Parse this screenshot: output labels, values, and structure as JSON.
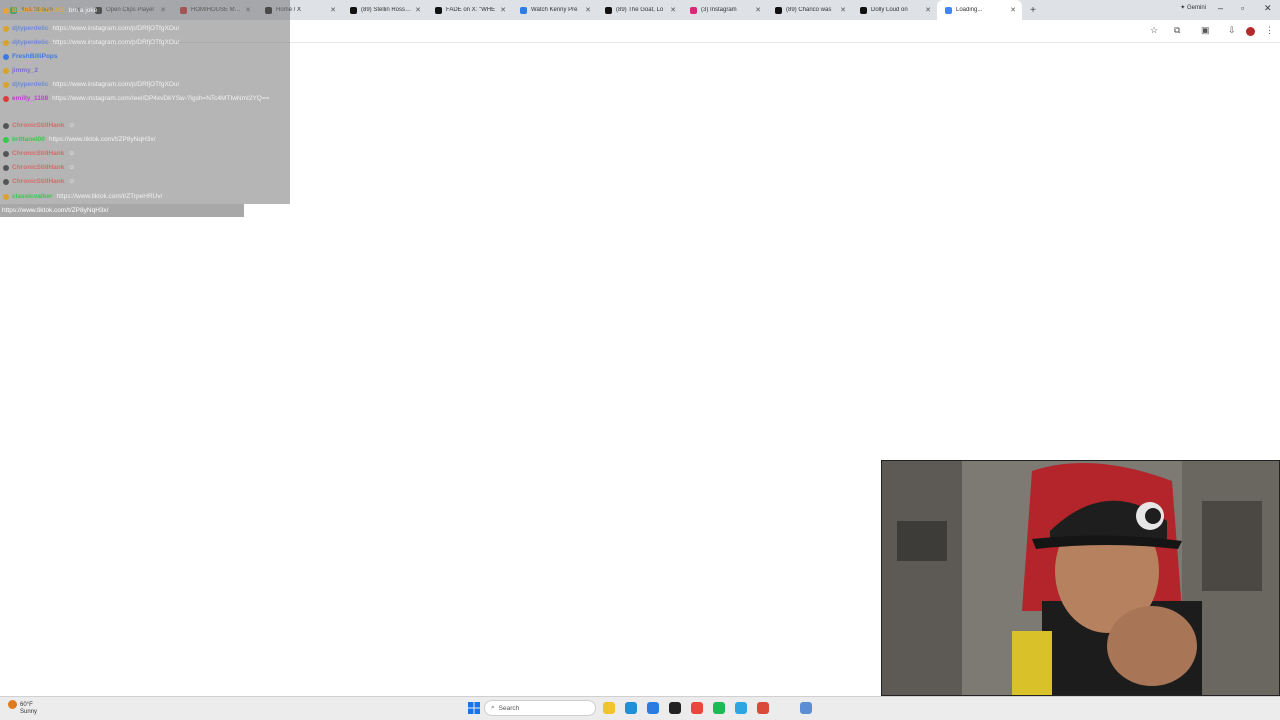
{
  "browser": {
    "tabs": [
      {
        "title": "Kick Stream",
        "color": "#2bd14b"
      },
      {
        "title": "Open Clips Player",
        "color": "#222222"
      },
      {
        "title": "HOMIHOUSE MU...",
        "color": "#e02424"
      },
      {
        "title": "Home / X",
        "color": "#111111"
      },
      {
        "title": "(89) Stellin Ross: In",
        "color": "#111111"
      },
      {
        "title": "FADE on X: \"WHE",
        "color": "#111111"
      },
      {
        "title": "Watch Kenny Pre",
        "color": "#2f7de1"
      },
      {
        "title": "(89) The Goat, Lo",
        "color": "#111111"
      },
      {
        "title": "(3) Instagram",
        "color": "#d62976"
      },
      {
        "title": "(89) Chanco was",
        "color": "#111111"
      },
      {
        "title": "Dolly Loud on",
        "color": "#111111"
      },
      {
        "title": "Loading...",
        "color": "#4285f4"
      }
    ],
    "gemini_label": "✦ Gemini",
    "new_tab_label": "+"
  },
  "chat": {
    "messages": [
      {
        "user": "BLURRED NAME",
        "user_color": "#e8a33a",
        "badge": "#e8a33a",
        "text": "bro a joke"
      },
      {
        "user": "djtyperdelic",
        "user_color": "#6d8cd6",
        "badge": "#d9a22b",
        "text": "https://www.instagram.com/p/DRfjOTfgXOu/"
      },
      {
        "user": "djtyperdelic",
        "user_color": "#6d8cd6",
        "badge": "#d9a22b",
        "text": "https://www.instagram.com/p/DRfjOTfgXOu/"
      },
      {
        "user": "FreshBilliPops",
        "user_color": "#3b7be0",
        "badge": "#3b7be0",
        "text": ""
      },
      {
        "user": "jimmy_2",
        "user_color": "#7c6ad0",
        "badge": "#d9a22b",
        "text": ""
      },
      {
        "user": "djtyperdelic",
        "user_color": "#6d8cd6",
        "badge": "#d9a22b",
        "text": "https://www.instagram.com/p/DRfjOTfgXOu/"
      },
      {
        "user": "emilly_1108",
        "user_color": "#c23bd6",
        "badge": "#e03b3b",
        "text": "https://www.instagram.com/reel/DP4xvDkYSw-?igsh=NTc4MTIwNmI2YQ=="
      },
      {
        "user": "ChronicStillHank",
        "user_color": "#d66a6a",
        "badge": "#555555",
        "text": "☺"
      },
      {
        "user": "brittanel00",
        "user_color": "#37c94a",
        "badge": "#37c94a",
        "text": "https://www.tiktok.com/t/ZP8yNqH3x/"
      },
      {
        "user": "ChronicStillHank",
        "user_color": "#d66a6a",
        "badge": "#555555",
        "text": "☺"
      },
      {
        "user": "ChronicStillHank",
        "user_color": "#d66a6a",
        "badge": "#555555",
        "text": "☺"
      },
      {
        "user": "ChronicStillHank",
        "user_color": "#d66a6a",
        "badge": "#555555",
        "text": "☺"
      },
      {
        "user": "classicvalker",
        "user_color": "#37c94a",
        "badge": "#d9a22b",
        "text": "https://www.tiktok.com/t/ZTrpeHRUv/"
      }
    ],
    "input_value": "https://www.tiktok.com/t/ZP8yNqH3x/"
  },
  "taskbar": {
    "weather_temp": "60°F",
    "weather_desc": "Sunny",
    "search_placeholder": "Search",
    "apps": [
      {
        "name": "file-explorer-icon",
        "color": "#f2c230"
      },
      {
        "name": "edge-icon",
        "color": "#1f8fd6"
      },
      {
        "name": "browser-icon",
        "color": "#2b7be0"
      },
      {
        "name": "tiktok-icon",
        "color": "#222222"
      },
      {
        "name": "chrome-icon",
        "color": "#e8483a"
      },
      {
        "name": "spotify-icon",
        "color": "#1db954"
      },
      {
        "name": "telegram-icon",
        "color": "#2ca5e0"
      },
      {
        "name": "ai-app-icon",
        "color": "#d94a3a"
      },
      {
        "name": "settings-app-icon",
        "color": "#5c8ed6"
      }
    ]
  }
}
